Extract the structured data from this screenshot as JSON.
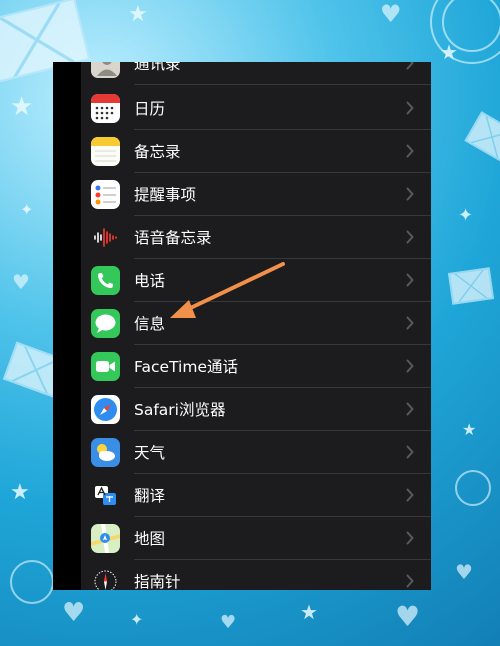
{
  "settings_list": {
    "items": [
      {
        "label": "通讯录",
        "icon": "contacts-icon"
      },
      {
        "label": "日历",
        "icon": "calendar-icon"
      },
      {
        "label": "备忘录",
        "icon": "notes-icon"
      },
      {
        "label": "提醒事项",
        "icon": "reminders-icon"
      },
      {
        "label": "语音备忘录",
        "icon": "voice-memos-icon"
      },
      {
        "label": "电话",
        "icon": "phone-icon"
      },
      {
        "label": "信息",
        "icon": "messages-icon"
      },
      {
        "label": "FaceTime通话",
        "icon": "facetime-icon"
      },
      {
        "label": "Safari浏览器",
        "icon": "safari-icon"
      },
      {
        "label": "天气",
        "icon": "weather-icon"
      },
      {
        "label": "翻译",
        "icon": "translate-icon"
      },
      {
        "label": "地图",
        "icon": "maps-icon"
      },
      {
        "label": "指南针",
        "icon": "compass-icon"
      }
    ]
  },
  "annotation": {
    "arrow_color": "#f0904a",
    "points_to": "信息"
  },
  "colors": {
    "list_background": "#1c1c1e",
    "separator": "#38383a",
    "text": "#ffffff",
    "chevron": "#5a5a5e",
    "frame_accent": "#1fa6d8"
  }
}
